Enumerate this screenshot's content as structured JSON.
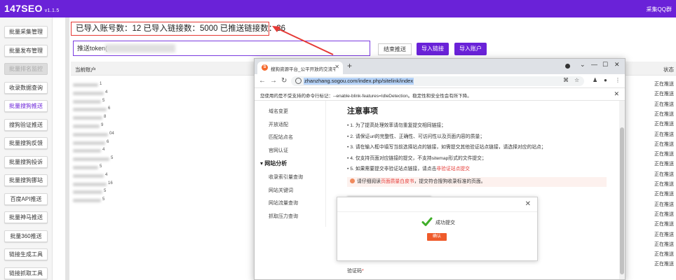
{
  "header": {
    "brand": "147SEO",
    "version": "v1.1.5",
    "right_link": "采集QQ群",
    "color": "#6a22d8"
  },
  "sidebar": {
    "items": [
      {
        "label": "批量采集管理",
        "state": "normal"
      },
      {
        "label": "批量发布管理",
        "state": "normal"
      },
      {
        "label": "批量排名监控",
        "state": "disabled"
      },
      {
        "label": "收录数据查询",
        "state": "normal"
      },
      {
        "label": "批量搜狗推送",
        "state": "active"
      },
      {
        "label": "搜狗验证推送",
        "state": "normal"
      },
      {
        "label": "批量搜狗反馈",
        "state": "normal"
      },
      {
        "label": "批量搜狗投诉",
        "state": "normal"
      },
      {
        "label": "批量搜狗挪站",
        "state": "normal"
      },
      {
        "label": "百度API推送",
        "state": "normal"
      },
      {
        "label": "批量神马推送",
        "state": "normal"
      },
      {
        "label": "批量360推送",
        "state": "normal"
      },
      {
        "label": "链接生成工具",
        "state": "normal"
      },
      {
        "label": "链接抓取工具",
        "state": "normal"
      }
    ]
  },
  "main": {
    "stats": "已导入账号数：12 已导入链接数：5000 已推送链接数：36",
    "token_input_value": "推送token(",
    "buttons": {
      "stop_push": "结束推送",
      "import_links": "导入链接",
      "import_accounts": "导入账户"
    },
    "table": {
      "col_current_account": "当前账户",
      "col_status": "状态",
      "row_fragments": [
        "1",
        "4",
        "5",
        "6",
        "8",
        "9",
        "04",
        "6",
        "4",
        "5",
        "5",
        "4",
        "16",
        "5",
        "5"
      ],
      "status_cells": [
        "正在推送",
        "正在推送",
        "正在推送",
        "正在推送",
        "正在推送",
        "正在推送",
        "正在推送",
        "正在推送",
        "正在推送",
        "正在推送",
        "正在推送",
        "正在推送",
        "正在推送",
        "正在推送",
        "正在推送",
        "正在推送",
        "正在推送",
        "正在推送",
        "正在推送"
      ]
    }
  },
  "browser": {
    "tab_title": "搜狗资源平台_公平开放的交流平台",
    "url": "zhanzhang.sogou.com/index.php/sitelink/index",
    "infobar": "您使用的是不受支持的命令行标记：--enable-blink-features=IdleDetection。稳定性和安全性会有所下降。",
    "nav": {
      "top_items": [
        "域名变更",
        "开放适配",
        "匹配站点名",
        "官网认证"
      ],
      "group": "网站分析",
      "group_items": [
        "收录索引量查询",
        "网站关键词",
        "网站流量查询",
        "抓取压力查询"
      ]
    },
    "notes": {
      "title": "注意事项",
      "items": [
        "1. 为了提高处理效率请勿重复提交相同链接；",
        "2. 请保证url的完整性、正确性、可访问性以及页面内容的质量；",
        "3. 请在输入框中填写当前选择站点的链接，如需提交其他验证站点链接，请选择对应的站点；",
        "4. 仅支持页面对应链接的提交，不支持sitemap形式的文件提交；"
      ],
      "item5_before": "5. 如果需要提交非验证站点链接，请点击",
      "item5_link": "非验证站点提交",
      "tip_before": "请仔细阅读",
      "tip_link": "页面质量白皮书",
      "tip_after": "，提交符合搜狗收录标准的页面。"
    },
    "captcha_label": "验证码",
    "captcha_required": "*"
  },
  "modal": {
    "message": "成功提交",
    "ok_label": "确认",
    "ok_color": "#ef5b2b"
  },
  "annotation": {
    "highlight_color": "#e53935"
  }
}
